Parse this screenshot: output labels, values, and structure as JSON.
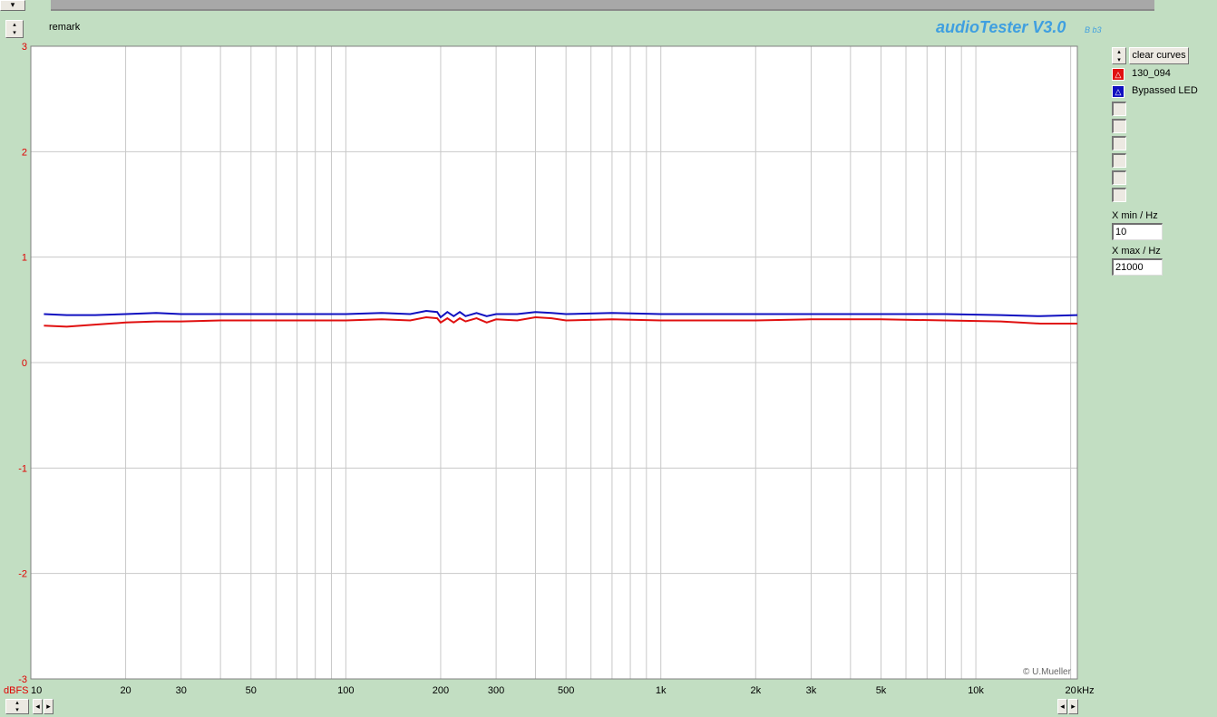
{
  "app": {
    "title": "audioTester V3.0",
    "subtitle": "B b3",
    "remark": "remark",
    "copyright": "© U.Mueller",
    "clear_label": "clear curves",
    "xmin_label": "X min / Hz",
    "xmin_value": "10",
    "xmax_label": "X max / Hz",
    "xmax_value": "21000",
    "y_unit": "dBFS",
    "x_unit": "kHz"
  },
  "legend": [
    {
      "name": "130_094",
      "color": "#e01010",
      "icon": "triangle-icon"
    },
    {
      "name": "Bypassed LED",
      "color": "#1010c0",
      "icon": "triangle-icon"
    }
  ],
  "chart_data": {
    "type": "line",
    "xscale": "log",
    "xlim": [
      10,
      21000
    ],
    "ylim": [
      -3,
      3
    ],
    "grid": true,
    "xticks": [
      {
        "v": 10,
        "label": "10"
      },
      {
        "v": 20,
        "label": "20"
      },
      {
        "v": 30,
        "label": "30"
      },
      {
        "v": 50,
        "label": "50"
      },
      {
        "v": 100,
        "label": "100"
      },
      {
        "v": 200,
        "label": "200"
      },
      {
        "v": 300,
        "label": "300"
      },
      {
        "v": 500,
        "label": "500"
      },
      {
        "v": 1000,
        "label": "1k"
      },
      {
        "v": 2000,
        "label": "2k"
      },
      {
        "v": 3000,
        "label": "3k"
      },
      {
        "v": 5000,
        "label": "5k"
      },
      {
        "v": 10000,
        "label": "10k"
      },
      {
        "v": 20000,
        "label": "20"
      }
    ],
    "yticks": [
      3,
      2,
      1,
      0,
      -1,
      -2,
      -3
    ],
    "series": [
      {
        "name": "130_094",
        "color": "#e01010",
        "points": [
          [
            11,
            0.35
          ],
          [
            13,
            0.34
          ],
          [
            16,
            0.36
          ],
          [
            20,
            0.38
          ],
          [
            25,
            0.39
          ],
          [
            30,
            0.39
          ],
          [
            40,
            0.4
          ],
          [
            50,
            0.4
          ],
          [
            70,
            0.4
          ],
          [
            100,
            0.4
          ],
          [
            130,
            0.41
          ],
          [
            160,
            0.4
          ],
          [
            180,
            0.43
          ],
          [
            195,
            0.42
          ],
          [
            200,
            0.38
          ],
          [
            210,
            0.42
          ],
          [
            220,
            0.38
          ],
          [
            230,
            0.42
          ],
          [
            240,
            0.39
          ],
          [
            260,
            0.42
          ],
          [
            280,
            0.38
          ],
          [
            300,
            0.41
          ],
          [
            350,
            0.4
          ],
          [
            400,
            0.43
          ],
          [
            450,
            0.42
          ],
          [
            500,
            0.4
          ],
          [
            700,
            0.41
          ],
          [
            1000,
            0.4
          ],
          [
            2000,
            0.4
          ],
          [
            3000,
            0.41
          ],
          [
            5000,
            0.41
          ],
          [
            8000,
            0.4
          ],
          [
            12000,
            0.39
          ],
          [
            16000,
            0.37
          ],
          [
            21000,
            0.37
          ]
        ]
      },
      {
        "name": "Bypassed LED",
        "color": "#1010c0",
        "points": [
          [
            11,
            0.46
          ],
          [
            13,
            0.45
          ],
          [
            16,
            0.45
          ],
          [
            20,
            0.46
          ],
          [
            25,
            0.47
          ],
          [
            30,
            0.46
          ],
          [
            40,
            0.46
          ],
          [
            50,
            0.46
          ],
          [
            70,
            0.46
          ],
          [
            100,
            0.46
          ],
          [
            130,
            0.47
          ],
          [
            160,
            0.46
          ],
          [
            180,
            0.49
          ],
          [
            195,
            0.48
          ],
          [
            200,
            0.43
          ],
          [
            210,
            0.48
          ],
          [
            220,
            0.44
          ],
          [
            230,
            0.48
          ],
          [
            240,
            0.44
          ],
          [
            260,
            0.47
          ],
          [
            280,
            0.44
          ],
          [
            300,
            0.46
          ],
          [
            350,
            0.46
          ],
          [
            400,
            0.48
          ],
          [
            450,
            0.47
          ],
          [
            500,
            0.46
          ],
          [
            700,
            0.47
          ],
          [
            1000,
            0.46
          ],
          [
            2000,
            0.46
          ],
          [
            3000,
            0.46
          ],
          [
            5000,
            0.46
          ],
          [
            8000,
            0.46
          ],
          [
            12000,
            0.45
          ],
          [
            16000,
            0.44
          ],
          [
            21000,
            0.45
          ]
        ]
      }
    ]
  }
}
